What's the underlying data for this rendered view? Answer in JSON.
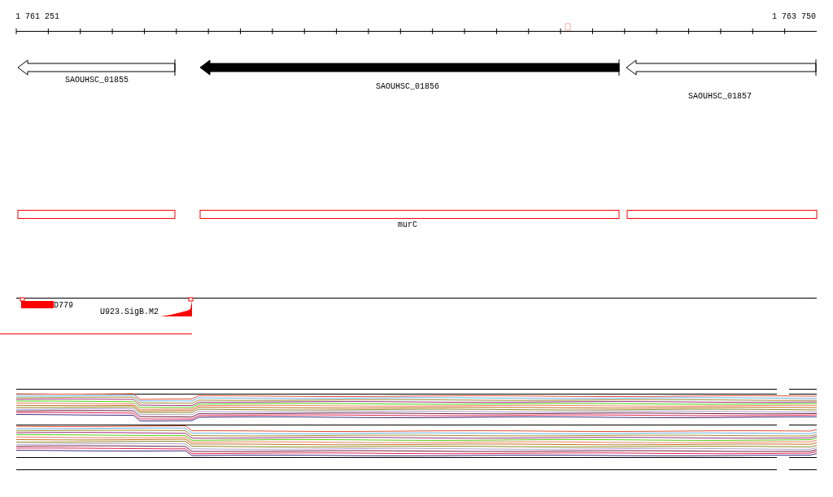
{
  "ruler": {
    "start": "1 761 251",
    "end": "1 763 750"
  },
  "genes": [
    {
      "label": "SAOUHSC_01855",
      "selected": false
    },
    {
      "label": "SAOUHSC_01856",
      "selected": true
    },
    {
      "label": "SAOUHSC_01857",
      "selected": false
    }
  ],
  "operons": [
    {
      "label": "murC"
    }
  ],
  "features": [
    {
      "label": "D779"
    },
    {
      "label": "U923.SigB.M2"
    }
  ]
}
